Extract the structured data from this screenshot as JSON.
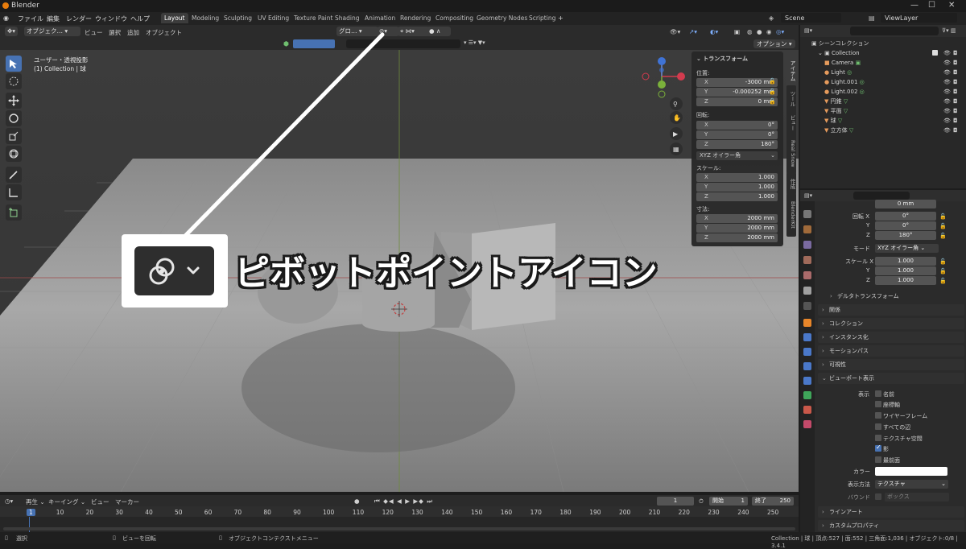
{
  "window": {
    "title": "Blender"
  },
  "menu": [
    "ファイル",
    "編集",
    "レンダー",
    "ウィンドウ",
    "ヘルプ"
  ],
  "workspaces": [
    "Layout",
    "Modeling",
    "Sculpting",
    "UV Editing",
    "Texture Paint",
    "Shading",
    "Animation",
    "Rendering",
    "Compositing",
    "Geometry Nodes",
    "Scripting"
  ],
  "active_workspace": "Layout",
  "scene": {
    "label": "Scene",
    "viewlayer": "ViewLayer"
  },
  "viewport_header": {
    "mode": "オブジェク…",
    "items": [
      "ビュー",
      "選択",
      "追加",
      "オブジェクト"
    ],
    "orientation": "グロ…",
    "options": "オプション"
  },
  "viewport": {
    "view_label": "ユーザー・透視投影",
    "collection_label": "(1) Collection | 球"
  },
  "npanel": {
    "title": "トランスフォーム",
    "location_label": "位置:",
    "location": [
      {
        "axis": "X",
        "value": "-3000 mm"
      },
      {
        "axis": "Y",
        "value": "-0.000252 mm"
      },
      {
        "axis": "Z",
        "value": "0 mm"
      }
    ],
    "rotation_label": "回転:",
    "rotation": [
      {
        "axis": "X",
        "value": "0°"
      },
      {
        "axis": "Y",
        "value": "0°"
      },
      {
        "axis": "Z",
        "value": "180°"
      }
    ],
    "rotation_mode": "XYZ オイラー角",
    "scale_label": "スケール:",
    "scale": [
      {
        "axis": "X",
        "value": "1.000"
      },
      {
        "axis": "Y",
        "value": "1.000"
      },
      {
        "axis": "Z",
        "value": "1.000"
      }
    ],
    "dimensions_label": "寸法:",
    "dimensions": [
      {
        "axis": "X",
        "value": "2000 mm"
      },
      {
        "axis": "Y",
        "value": "2000 mm"
      },
      {
        "axis": "Z",
        "value": "2000 mm"
      }
    ],
    "tabs": [
      "アイテム",
      "ツール",
      "ビュー",
      "Real Snow",
      "作成",
      "BlenderKit"
    ]
  },
  "outliner": {
    "header": "シーンコレクション",
    "items": [
      "Collection",
      "Camera",
      "Light",
      "Light.001",
      "Light.002",
      "円錐",
      "平面",
      "球",
      "立方体"
    ]
  },
  "properties": {
    "z_value": "0 mm",
    "rotation_label": "回転 X",
    "rot_y": "Y",
    "rot_z": "Z",
    "rot_x_value": "0°",
    "rot_y_value": "0°",
    "rot_z_value": "180°",
    "mode_label": "モード",
    "mode_value": "XYZ オイラー角",
    "scale_label": "スケール X",
    "scale_y": "Y",
    "scale_z": "Z",
    "scale_values": [
      "1.000",
      "1.000",
      "1.000"
    ],
    "sections": [
      "デルタトランスフォーム",
      "関係",
      "コレクション",
      "インスタンス化",
      "モーションパス",
      "可視性",
      "ビューポート表示"
    ],
    "display_label": "表示",
    "display_options": [
      "名前",
      "座標軸",
      "ワイヤーフレーム",
      "すべての辺",
      "テクスチャ空間",
      "影",
      "最前面"
    ],
    "color_label": "カラー",
    "display_as_label": "表示方法",
    "display_as_value": "テクスチャ",
    "bounds_label": "バウンド",
    "bounds_value": "ボックス",
    "bottom_sections": [
      "ラインアート",
      "カスタムプロパティ"
    ]
  },
  "timeline": {
    "items": [
      "再生",
      "キーイング",
      "ビュー",
      "マーカー"
    ],
    "current_frame": "1",
    "start_label": "開始",
    "start": "1",
    "end_label": "終了",
    "end": "250",
    "frames": [
      "1",
      "10",
      "20",
      "30",
      "40",
      "50",
      "60",
      "70",
      "80",
      "90",
      "100",
      "110",
      "120",
      "130",
      "140",
      "150",
      "160",
      "170",
      "180",
      "190",
      "200",
      "210",
      "220",
      "230",
      "240",
      "250"
    ]
  },
  "status": {
    "select": "選択",
    "rotate": "ビューを回転",
    "context": "オブジェクトコンテクストメニュー",
    "stats": "Collection | 球 | 頂点:527 | 面:552 | 三角面:1,036 | オブジェクト:0/8 | 3.4.1"
  },
  "callout": {
    "text": "ピボットポイントアイコン"
  }
}
